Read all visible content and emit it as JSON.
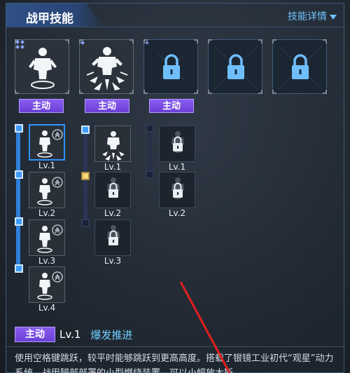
{
  "header": {
    "title": "战甲技能",
    "detail_label": "技能详情"
  },
  "skills": [
    {
      "badge": "主动",
      "state": "unlocked",
      "icon": "jump-figure-icon"
    },
    {
      "badge": "主动",
      "state": "unlocked",
      "icon": "burst-figure-icon"
    },
    {
      "badge": "主动",
      "state": "locked",
      "icon": "lock-icon"
    },
    {
      "badge": "",
      "state": "locked",
      "icon": "lock-icon"
    },
    {
      "badge": "",
      "state": "locked",
      "icon": "lock-icon"
    }
  ],
  "upgrade_tree": {
    "column1": [
      "Lv.1",
      "Lv.2",
      "Lv.3",
      "Lv.4"
    ],
    "column2": [
      "Lv.1",
      "Lv.2",
      "Lv.3"
    ],
    "column3": [
      "Lv.1",
      "Lv.2"
    ]
  },
  "footer": {
    "badge": "主动",
    "level": "Lv.1",
    "skill_name": "爆发推进",
    "description": "使用空格键跳跃，较平时能够跳跃到更高高度。搭载了银镜工业初代“观星”动力系统，战甲腿部部署的小型燃烧装置，可以小幅放大斯"
  },
  "colors": {
    "accent_blue": "#2f92ff",
    "badge_purple": "#7a4de8",
    "skill_name_cyan": "#6fd0ff",
    "arrow_red": "#e11f1f"
  }
}
